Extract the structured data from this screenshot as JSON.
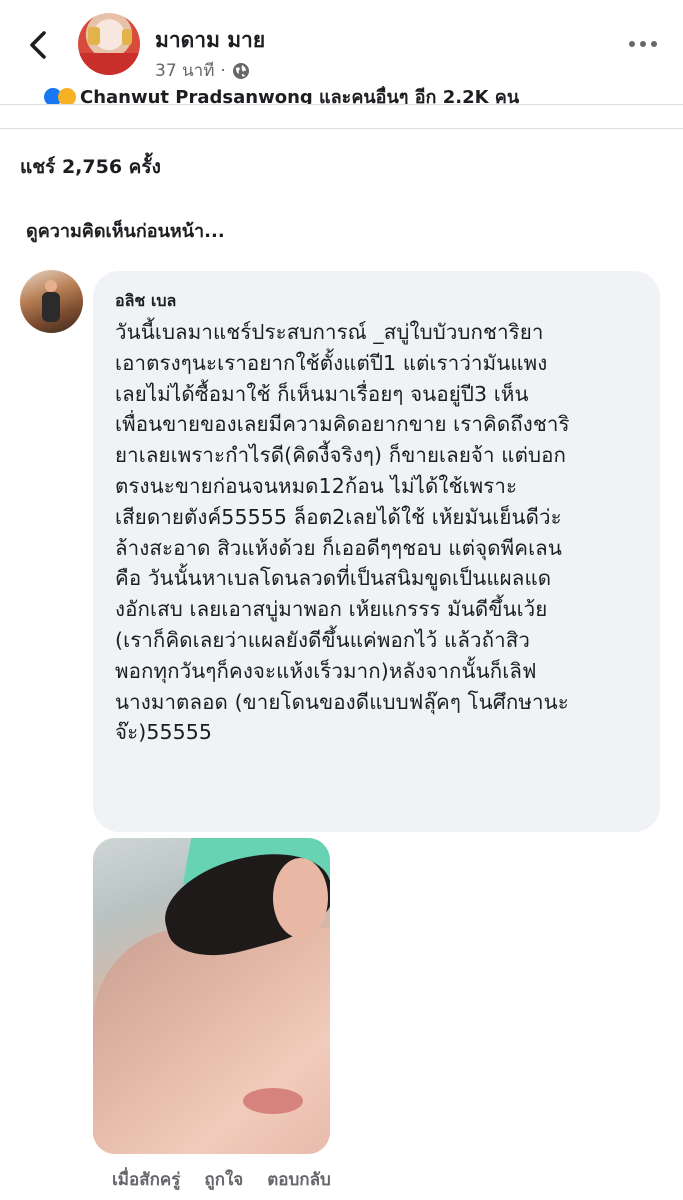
{
  "header": {
    "page_name": "มาดาม มาย",
    "time": "37 นาที",
    "separator": "·"
  },
  "reactions": {
    "names_partial": "Chanwut Pradsanwong และคนอื่นๆ อีก 2.2K คน"
  },
  "shares": "แชร์ 2,756 ครั้ง",
  "view_previous": "ดูความคิดเห็นก่อนหน้า...",
  "comment": {
    "author": "อลิช เบล",
    "text": "วันนี้เบลมาแชร์ประสบการณ์ _สบู่ใบบัวบกชาริยา\nเอาตรงๆนะเราอยากใช้ตั้งแต่ปี1 แต่เราว่ามันแพง\nเลยไม่ได้ซื้อมาใช้ ก็เห็นมาเรื่อยๆ จนอยู่ปี3 เห็น\nเพื่อนขายของเลยมีความคิดอยากขาย เราคิดถึงชาริ\nยาเลยเพราะกำไรดี(คิดงี้จริงๆ) ก็ขายเลยจ้า แต่บอก\nตรงนะขายก่อนจนหมด12ก้อน ไม่ได้ใช้เพราะ\nเสียดายตังค์55555 ล็อต2เลยได้ใช้ เห้ยมันเย็นดีว่ะ\nล้างสะอาด สิวแห้งด้วย ก็เออดีๆๆชอบ แต่จุดพีคเลน\nคือ วันนั้นหาเบลโดนลวดที่เป็นสนิมขูดเป็นแผลแด\nงอักเสบ เลยเอาสบู่มาพอก เห้ยแกรรร มันดีขึ้นเว้ย\n(เราก็คิดเลยว่าแผลยังดีขึ้นแค่พอกไว้ แล้วถ้าสิว\nพอกทุกวันๆก็คงจะแห้งเร็วมาก)หลังจากนั้นก็เลิฟ\nนางมาตลอด (ขายโดนของดีแบบฟลุ๊คๆ โนศึกษานะ\nจ๊ะ)55555"
  },
  "actions": {
    "time": "เมื่อสักครู่",
    "like": "ถูกใจ",
    "reply": "ตอบกลับ"
  },
  "colors": {
    "secondary_text": "#65676b",
    "bubble": "#f0f2f5",
    "like_blue": "#1877f2",
    "haha_yellow": "#f7b125"
  }
}
